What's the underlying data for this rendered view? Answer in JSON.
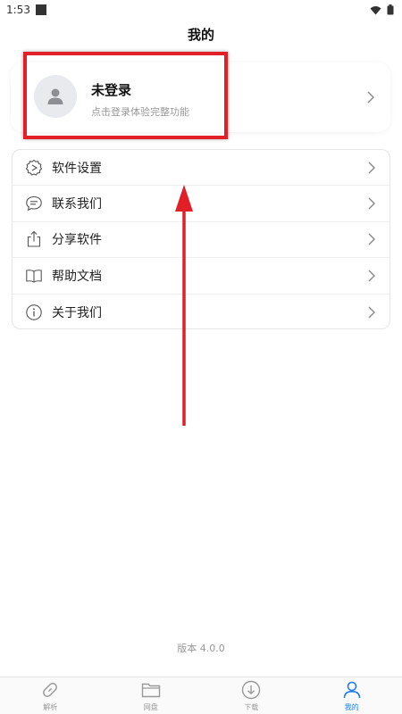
{
  "status_bar": {
    "time": "1:53"
  },
  "header": {
    "title": "我的"
  },
  "profile": {
    "name": "未登录",
    "subtitle": "点击登录体验完整功能"
  },
  "menu": {
    "items": [
      {
        "label": "软件设置",
        "icon": "settings-icon"
      },
      {
        "label": "联系我们",
        "icon": "chat-icon"
      },
      {
        "label": "分享软件",
        "icon": "share-icon"
      },
      {
        "label": "帮助文档",
        "icon": "book-icon"
      },
      {
        "label": "关于我们",
        "icon": "info-icon"
      }
    ]
  },
  "footer": {
    "version": "版本 4.0.0"
  },
  "tabbar": {
    "items": [
      {
        "label": "解析",
        "icon": "link-icon",
        "active": false
      },
      {
        "label": "网盘",
        "icon": "folder-icon",
        "active": false
      },
      {
        "label": "下载",
        "icon": "download-icon",
        "active": false
      },
      {
        "label": "我的",
        "icon": "user-icon",
        "active": true
      }
    ]
  },
  "colors": {
    "accent": "#1e7cf2",
    "annotation": "#e21f26"
  }
}
